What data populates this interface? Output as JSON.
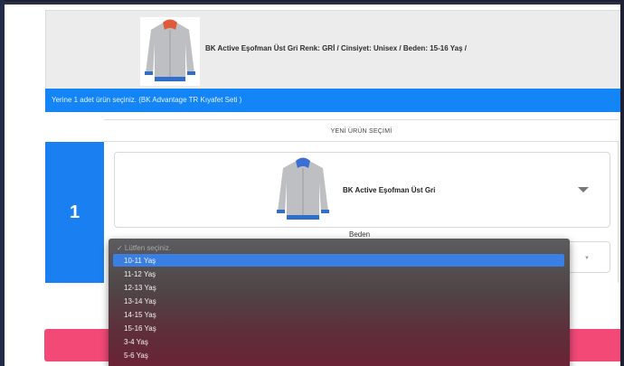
{
  "product": {
    "description": "BK Active Eşofman Üst Gri  Renk:  GRİ /  Cinsiyet:  Unisex /  Beden:  15-16 Yaş /"
  },
  "info": {
    "message": "Yerine 1 adet ürün seçiniz. (BK Advantage TR Kıyafet Seti )"
  },
  "selection": {
    "header": "YENİ ÜRÜN SEÇİMİ",
    "index": "1",
    "product_name": "BK Active Eşofman Üst Gri",
    "size_label": "Beden"
  },
  "dropdown": {
    "placeholder": "✓ Lütfen seçiniz.",
    "options": [
      "10-11 Yaş",
      "11-12 Yaş",
      "12-13 Yaş",
      "13-14 Yaş",
      "14-15 Yaş",
      "15-16 Yaş",
      "3-4 Yaş",
      "5-6 Yaş"
    ],
    "highlighted": "10-11 Yaş"
  },
  "colors": {
    "accent_blue": "#1385f7",
    "button_pink": "#f24977",
    "highlight_blue": "#3a7fe3"
  }
}
